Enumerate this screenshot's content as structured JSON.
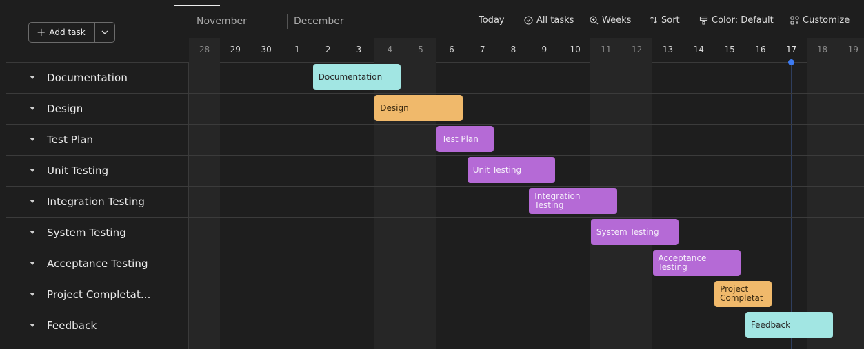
{
  "toolbar": {
    "add_task_label": "Add task",
    "today_label": "Today",
    "all_tasks_label": "All tasks",
    "weeks_label": "Weeks",
    "sort_label": "Sort",
    "color_label": "Color: Default",
    "customize_label": "Customize"
  },
  "timeline": {
    "months": [
      "November",
      "December"
    ],
    "days": [
      {
        "label": "28",
        "weekend": true
      },
      {
        "label": "29",
        "weekend": false
      },
      {
        "label": "30",
        "weekend": false
      },
      {
        "label": "1",
        "weekend": false
      },
      {
        "label": "2",
        "weekend": false
      },
      {
        "label": "3",
        "weekend": false
      },
      {
        "label": "4",
        "weekend": true
      },
      {
        "label": "5",
        "weekend": true
      },
      {
        "label": "6",
        "weekend": false
      },
      {
        "label": "7",
        "weekend": false
      },
      {
        "label": "8",
        "weekend": false
      },
      {
        "label": "9",
        "weekend": false
      },
      {
        "label": "10",
        "weekend": false
      },
      {
        "label": "11",
        "weekend": true
      },
      {
        "label": "12",
        "weekend": true
      },
      {
        "label": "13",
        "weekend": false
      },
      {
        "label": "14",
        "weekend": false
      },
      {
        "label": "15",
        "weekend": false
      },
      {
        "label": "16",
        "weekend": false
      },
      {
        "label": "17",
        "weekend": false
      },
      {
        "label": "18",
        "weekend": true
      },
      {
        "label": "19",
        "weekend": true
      }
    ],
    "today": "17"
  },
  "tasks": [
    {
      "name": "Documentation",
      "bar_label": "Documentation",
      "start": "2",
      "end": "4",
      "color": "#a2e6e3"
    },
    {
      "name": "Design",
      "bar_label": "Design",
      "start": "4",
      "end": "6",
      "color": "#f0b96b"
    },
    {
      "name": "Test Plan",
      "bar_label": "Test Plan",
      "start": "6",
      "end": "7",
      "color": "#b56ad6"
    },
    {
      "name": "Unit Testing",
      "bar_label": "Unit Testing",
      "start": "7",
      "end": "9",
      "color": "#b56ad6"
    },
    {
      "name": "Integration Testing",
      "bar_label": "Integration Testing",
      "start": "9",
      "end": "11",
      "color": "#b56ad6"
    },
    {
      "name": "System Testing",
      "bar_label": "System Testing",
      "start": "11",
      "end": "13",
      "color": "#b56ad6"
    },
    {
      "name": "Acceptance Testing",
      "bar_label": "Acceptance Testing",
      "start": "13",
      "end": "15",
      "color": "#b56ad6"
    },
    {
      "name": "Project Completat...",
      "bar_label": "Project Completat",
      "start": "15",
      "end": "16",
      "color": "#f0b96b"
    },
    {
      "name": "Feedback",
      "bar_label": "Feedback",
      "start": "16",
      "end": "18",
      "color": "#a2e6e3"
    }
  ]
}
